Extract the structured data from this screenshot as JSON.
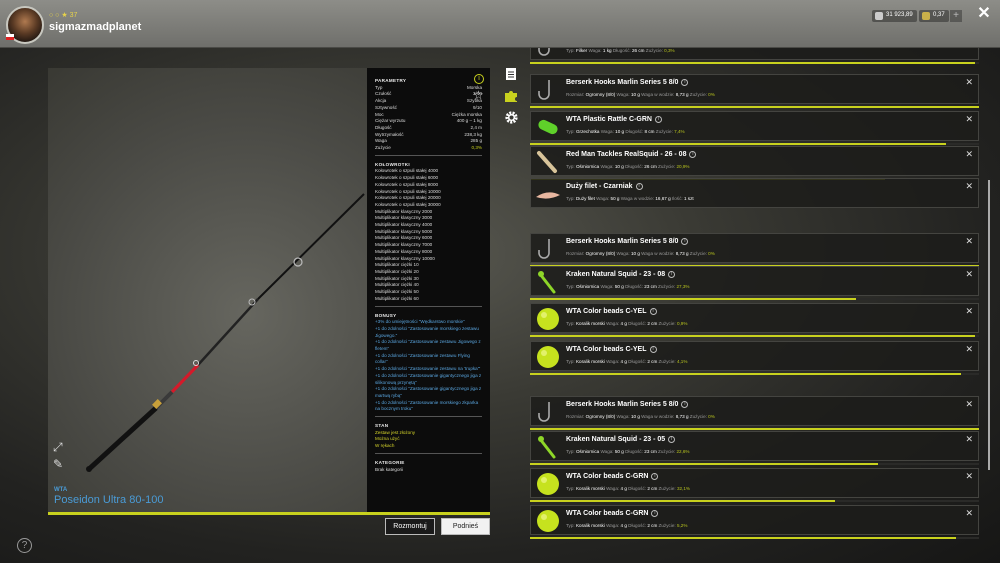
{
  "user": {
    "level_line": "○ ○ ★ 37",
    "name": "sigmazmadplanet"
  },
  "currency": [
    {
      "value": "31 923,89"
    },
    {
      "value": "0,37"
    }
  ],
  "top": {
    "plus": "+",
    "close": "✕"
  },
  "rod": {
    "brand": "WTA",
    "name": "Poseidon Ultra 80-100"
  },
  "stats": {
    "params_title": "PARAMETRY",
    "params": [
      {
        "k": "Typ",
        "v": "Morska"
      },
      {
        "k": "Czułość",
        "v": "3/10"
      },
      {
        "k": "Akcja",
        "v": "Szybka"
      },
      {
        "k": "Sztywność",
        "v": "9/10"
      },
      {
        "k": "Moc",
        "v": "Ciężka morska"
      },
      {
        "k": "Ciężar wyrzutu",
        "v": "400 g – 1 kg"
      },
      {
        "k": "Długość",
        "v": "2,4 m"
      },
      {
        "k": "Wytrzymałość",
        "v": "238,3 kg"
      },
      {
        "k": "Waga",
        "v": "285 g"
      },
      {
        "k": "Zużycie",
        "v": "0,3%"
      }
    ],
    "reels_title": "KOŁOWROTKI",
    "reels": [
      "Kołowrotek o szpuli stałej 4000",
      "Kołowrotek o szpuli stałej 6000",
      "Kołowrotek o szpuli stałej 8000",
      "Kołowrotek o szpuli stałej 10000",
      "Kołowrotek o szpuli stałej 20000",
      "Kołowrotek o szpuli stałej 30000",
      "Multiplikator klasyczny 2000",
      "Multiplikator klasyczny 3000",
      "Multiplikator klasyczny 4000",
      "Multiplikator klasyczny 5000",
      "Multiplikator klasyczny 6000",
      "Multiplikator klasyczny 7000",
      "Multiplikator klasyczny 8000",
      "Multiplikator klasyczny 10000",
      "Multiplikator ciężki 10",
      "Multiplikator ciężki 20",
      "Multiplikator ciężki 30",
      "Multiplikator ciężki 40",
      "Multiplikator ciężki 50",
      "Multiplikator ciężki 60"
    ],
    "bonus_title": "BONUSY",
    "bonuses": [
      "+3% do umiejętności \"Wędkarstwo morskie\"",
      "+1 do zdolności \"Zastosowanie morskiego zestawu Jigowego.\"",
      "+1 do zdolności \"Zastosowanie zestawu Jigowego z fletem\"",
      "+1 do zdolności \"Zastosowanie zestawu Flying collar\"",
      "+1 do zdolności \"Zastosowanie zestawu na 'trupka'\"",
      "+1 do zdolności \"Zastosowanie gigantycznego jiga z silikonową przynętą\"",
      "+1 do zdolności \"Zastosowanie gigantycznego jiga z martwą rybą\"",
      "+1 do zdolności \"Zastosowanie morskiego zkparka na bocznym troku\""
    ],
    "state_title": "STAN",
    "states": [
      "Zestaw jest złożony",
      "Można użyć",
      "W rękach"
    ],
    "cat_title": "KATEGORIE",
    "cat": "Brak kategorii"
  },
  "buttons": {
    "dismantle": "Rozmontuj",
    "pickup": "Podnieś"
  },
  "icons": {
    "help": "?",
    "info": "i",
    "star": "☆",
    "expand": "⤢",
    "pen": "✎",
    "close": "✕"
  },
  "items": [
    {
      "name": "",
      "meta_html": "Typ: <b>Filker</b> Waga: <b>1 kg</b> Długość: <b>26 cm</b> Zużycie: <span class='g'>0,3%</span>",
      "thumb": "hook",
      "wear": 0.99
    },
    {
      "name": "Berserk Hooks Marlin Series 5 8/0",
      "meta_html": "Rozmiar: <b>Ogromny (8/0)</b> Waga: <b>10 g</b> Waga w wodzie: <b>8,73 g</b> Zużycie: <span class='g'>0%</span>",
      "thumb": "hook",
      "wear": 1.0
    },
    {
      "name": "WTA Plastic Rattle C-GRN",
      "meta_html": "Typ: <b>Grzechotka</b> Waga: <b>10 g</b> Długość: <b>8 cm</b> Zużycie: <span class='g'>7,4%</span>",
      "thumb": "rattle",
      "wear": 0.926
    },
    {
      "name": "Red Man Tackles RealSquid - 26 - 08",
      "meta_html": "Typ: <b>Ośmiornica</b> Waga: <b>10 g</b> Długość: <b>26 cm</b> Zużycie: <span class='g'>20,9%</span>",
      "thumb": "squid",
      "wear": 0.791
    },
    {
      "name": "Duży filet - Czarniak",
      "meta_html": "Typ: <b>Duży filet</b> Waga: <b>50 g</b> Waga w wodzie: <b>16,67 g</b> Ilość: <b>1 szt</b>",
      "thumb": "fillet",
      "wear": null
    },
    {
      "name": "Berserk Hooks Marlin Series 5 8/0",
      "meta_html": "Rozmiar: <b>Ogromny (8/0)</b> Waga: <b>10 g</b> Waga w wodzie: <b>8,73 g</b> Zużycie: <span class='g'>0%</span>",
      "thumb": "hook",
      "wear": 1.0
    },
    {
      "name": "Kraken Natural Squid - 23 - 08",
      "meta_html": "Typ: <b>Ośmiornica</b> Waga: <b>50 g</b> Długość: <b>23 cm</b> Zużycie: <span class='g'>27,3%</span>",
      "thumb": "kraken",
      "wear": 0.727
    },
    {
      "name": "WTA Color beads C-YEL",
      "meta_html": "Typ: <b>Koralik morski</b> Waga: <b>4 g</b> Długość: <b>2 cm</b> Zużycie: <span class='g'>0,9%</span>",
      "thumb": "bead",
      "wear": 0.991
    },
    {
      "name": "WTA Color beads C-YEL",
      "meta_html": "Typ: <b>Koralik morski</b> Waga: <b>4 g</b> Długość: <b>2 cm</b> Zużycie: <span class='g'>4,1%</span>",
      "thumb": "bead",
      "wear": 0.959
    },
    {
      "name": "Berserk Hooks Marlin Series 5 8/0",
      "meta_html": "Rozmiar: <b>Ogromny (8/0)</b> Waga: <b>10 g</b> Waga w wodzie: <b>8,73 g</b> Zużycie: <span class='g'>0%</span>",
      "thumb": "hook",
      "wear": 1.0
    },
    {
      "name": "Kraken Natural Squid - 23 - 05",
      "meta_html": "Typ: <b>Ośmiornica</b> Waga: <b>50 g</b> Długość: <b>23 cm</b> Zużycie: <span class='g'>22,6%</span>",
      "thumb": "kraken",
      "wear": 0.774
    },
    {
      "name": "WTA Color beads C-GRN",
      "meta_html": "Typ: <b>Koralik morski</b> Waga: <b>4 g</b> Długość: <b>2 cm</b> Zużycie: <span class='g'>32,1%</span>",
      "thumb": "bead",
      "wear": 0.679
    },
    {
      "name": "WTA Color beads C-GRN",
      "meta_html": "Typ: <b>Koralik morski</b> Waga: <b>4 g</b> Długość: <b>2 cm</b> Zużycie: <span class='g'>5,2%</span>",
      "thumb": "bead",
      "wear": 0.948
    }
  ],
  "colors": {
    "accent": "#c8d11e",
    "link": "#4a9bd6",
    "bead_yellow": "#c6e21e",
    "bead_green": "#8ed628"
  }
}
